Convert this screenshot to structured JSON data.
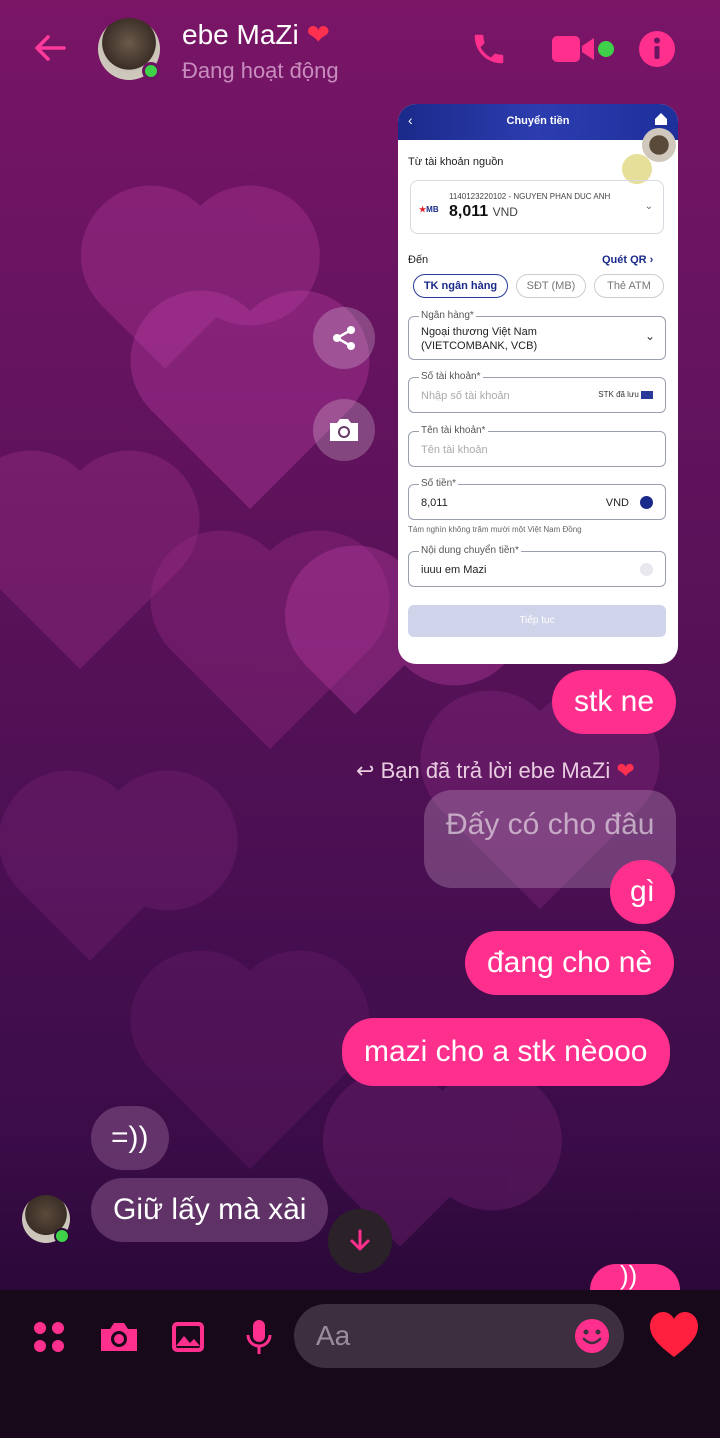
{
  "header": {
    "contact_name": "ebe MaZi",
    "status": "Đang hoạt động"
  },
  "card": {
    "title": "Chuyển tiền",
    "from_label": "Từ tài khoản nguồn",
    "account_line": "1140123220102 - NGUYEN PHAN DUC ANH",
    "bank_logo_text": "MB",
    "balance": "8,011",
    "balance_currency": "VND",
    "to_label": "Đến",
    "qr_link": "Quét QR",
    "tabs": [
      "TK ngân hàng",
      "SĐT (MB)",
      "Thẻ ATM"
    ],
    "bank_label": "Ngân hàng*",
    "bank_value_line1": "Ngoại thương Việt Nam",
    "bank_value_line2": "(VIETCOMBANK, VCB)",
    "acct_no_label": "Số tài khoản*",
    "acct_no_placeholder": "Nhập số tài khoản",
    "saved_acct": "STK đã lưu",
    "acct_name_label": "Tên tài khoản*",
    "acct_name_placeholder": "Tên tài khoản",
    "amount_label": "Số tiền*",
    "amount_value": "8,011",
    "amount_currency": "VND",
    "amount_words": "Tám nghìn không trăm mười một Việt Nam Đồng",
    "note_label": "Nội dung chuyển tiền*",
    "note_value": "iuuu em Mazi",
    "continue_btn": "Tiếp tục"
  },
  "messages": {
    "m1": "stk ne",
    "reply_label": "Bạn đã trả lời ebe MaZi",
    "quoted": "Đấy có cho đâu",
    "m2": "gì",
    "m3": "đang cho nè",
    "m4": "mazi cho a stk nèooo",
    "t1": "=))",
    "t2": "Giữ lấy mà xài",
    "partial": "))"
  },
  "composer": {
    "placeholder": "Aa"
  },
  "colors": {
    "accent": "#ff2f8e",
    "online": "#3fd14a"
  }
}
